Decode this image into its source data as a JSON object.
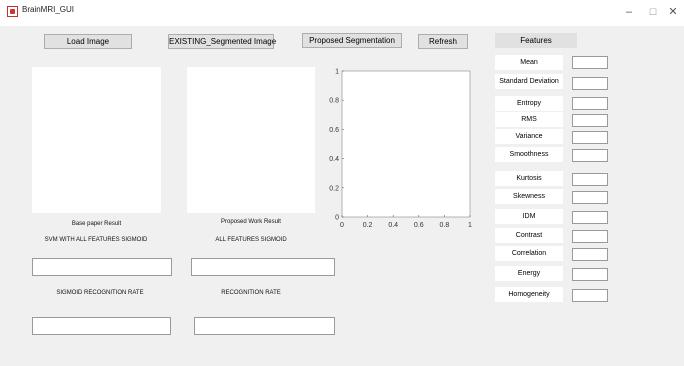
{
  "window": {
    "title": "BrainMRI_GUI",
    "minimize": "–",
    "maximize": "☐",
    "close": "✕"
  },
  "toolbar": {
    "load_image": "Load Image",
    "existing_segmented": "EXISTING_Segmented Image",
    "proposed_segmentation": "Proposed Segmentation",
    "refresh": "Refresh"
  },
  "left": {
    "base_caption": "Base paper Result",
    "svm_label": "SVM WITH ALL FEATURES SIGMOID",
    "sigmoid_rate_label": "SIGMOID RECOGNITION RATE"
  },
  "middle": {
    "proposed_caption": "Proposed Work Result",
    "all_features_label": "ALL FEATURES SIGMOID",
    "recognition_rate_label": "RECOGNITION RATE"
  },
  "axes": {
    "x_ticks": [
      "0",
      "0.2",
      "0.4",
      "0.6",
      "0.8",
      "1"
    ],
    "y_ticks": [
      "0",
      "0.2",
      "0.4",
      "0.6",
      "0.8",
      "1"
    ]
  },
  "features": {
    "header": "Features",
    "items": [
      "Mean",
      "Standard Deviation",
      "Entropy",
      "RMS",
      "Variance",
      "Smoothness",
      "Kurtosis",
      "Skewness",
      "IDM",
      "Contrast",
      "Correlation",
      "Energy",
      "Homogeneity"
    ]
  }
}
